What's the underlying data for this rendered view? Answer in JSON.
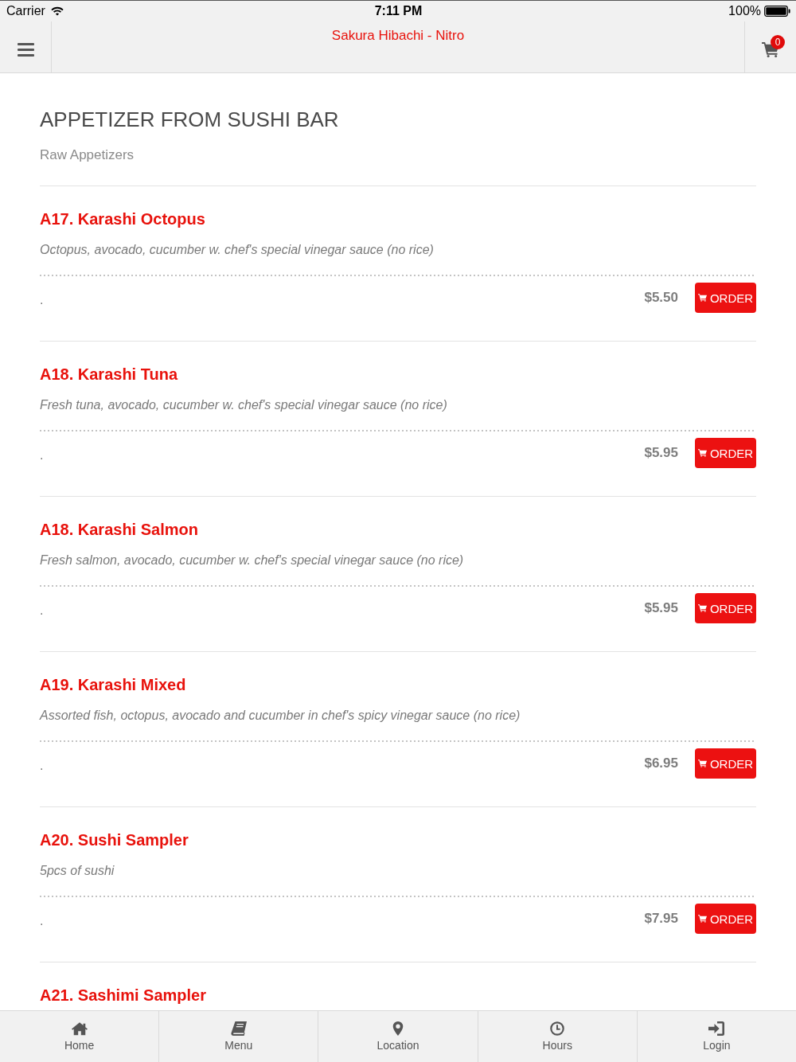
{
  "status_bar": {
    "carrier": "Carrier",
    "time": "7:11 PM",
    "battery": "100%"
  },
  "header": {
    "title": "Sakura Hibachi - Nitro",
    "cart_count": "0"
  },
  "section": {
    "title": "APPETIZER FROM SUSHI BAR",
    "subtitle": "Raw Appetizers"
  },
  "items": [
    {
      "name": "A17. Karashi Octopus",
      "description": "Octopus, avocado, cucumber w. chef's special vinegar sauce (no rice)",
      "option": ".",
      "price": "$5.50",
      "button": "ORDER"
    },
    {
      "name": "A18. Karashi Tuna",
      "description": "Fresh tuna, avocado, cucumber w. chef's special vinegar sauce (no rice)",
      "option": ".",
      "price": "$5.95",
      "button": "ORDER"
    },
    {
      "name": "A18. Karashi Salmon",
      "description": "Fresh salmon, avocado, cucumber w. chef's special vinegar sauce (no rice)",
      "option": ".",
      "price": "$5.95",
      "button": "ORDER"
    },
    {
      "name": "A19. Karashi Mixed",
      "description": "Assorted fish, octopus, avocado and cucumber in chef's spicy vinegar sauce (no rice)",
      "option": ".",
      "price": "$6.95",
      "button": "ORDER"
    },
    {
      "name": "A20. Sushi Sampler",
      "description": "5pcs of sushi",
      "option": ".",
      "price": "$7.95",
      "button": "ORDER"
    },
    {
      "name": "A21. Sashimi Sampler"
    }
  ],
  "tab_bar": [
    {
      "label": "Home"
    },
    {
      "label": "Menu"
    },
    {
      "label": "Location"
    },
    {
      "label": "Hours"
    },
    {
      "label": "Login"
    }
  ]
}
